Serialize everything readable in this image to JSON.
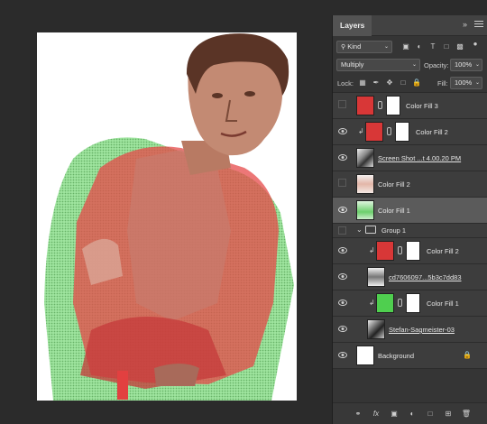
{
  "panel": {
    "tab_label": "Layers",
    "expand_glyph": "»",
    "menu_icon": "hamburger-icon",
    "filter_label": "Kind",
    "blend_mode": "Multiply",
    "opacity_label": "Opacity:",
    "opacity_value": "100%",
    "lock_label": "Lock:",
    "fill_label": "Fill:",
    "fill_value": "100%"
  },
  "layers": [
    {
      "name": "Color Fill 3",
      "visible": false,
      "thumb_color": "#d83737",
      "clipped": false,
      "mask": true
    },
    {
      "name": "Color Fill 2",
      "visible": true,
      "thumb_color": "#d83737",
      "clipped": true,
      "mask": true
    },
    {
      "name": "Screen Shot ...t 4.00.20 PM",
      "visible": true,
      "thumb": "photo",
      "clipped": false,
      "mask": false,
      "underlined": true
    },
    {
      "name": "Color Fill 2",
      "visible": false,
      "thumb": "halftone",
      "clipped": false,
      "mask": false
    },
    {
      "name": "Color Fill 1",
      "visible": true,
      "thumb": "green-halftone",
      "clipped": false,
      "mask": false,
      "selected": true
    },
    {
      "name": "Group 1",
      "visible": false,
      "group": true
    },
    {
      "name": "Color Fill 2",
      "visible": true,
      "thumb_color": "#d83737",
      "clipped": true,
      "mask": true
    },
    {
      "name": "cd7606097...5b3c7dd83",
      "visible": true,
      "thumb": "photo-small",
      "clipped": false,
      "mask": false,
      "underlined": true
    },
    {
      "name": "Color Fill 1",
      "visible": true,
      "thumb_color": "#4fcf4f",
      "clipped": true,
      "mask": true
    },
    {
      "name": "Stefan-Sagmeister-03",
      "visible": true,
      "thumb": "photo",
      "clipped": false,
      "mask": false,
      "underlined": true
    },
    {
      "name": "Background",
      "visible": true,
      "thumb_color": "#ffffff",
      "clipped": false,
      "mask": false,
      "locked": true
    }
  ],
  "colors": {
    "fill_red": "#d83737",
    "fill_green": "#4fcf4f",
    "panel_bg": "#353535",
    "app_bg": "#2b2b2b"
  }
}
